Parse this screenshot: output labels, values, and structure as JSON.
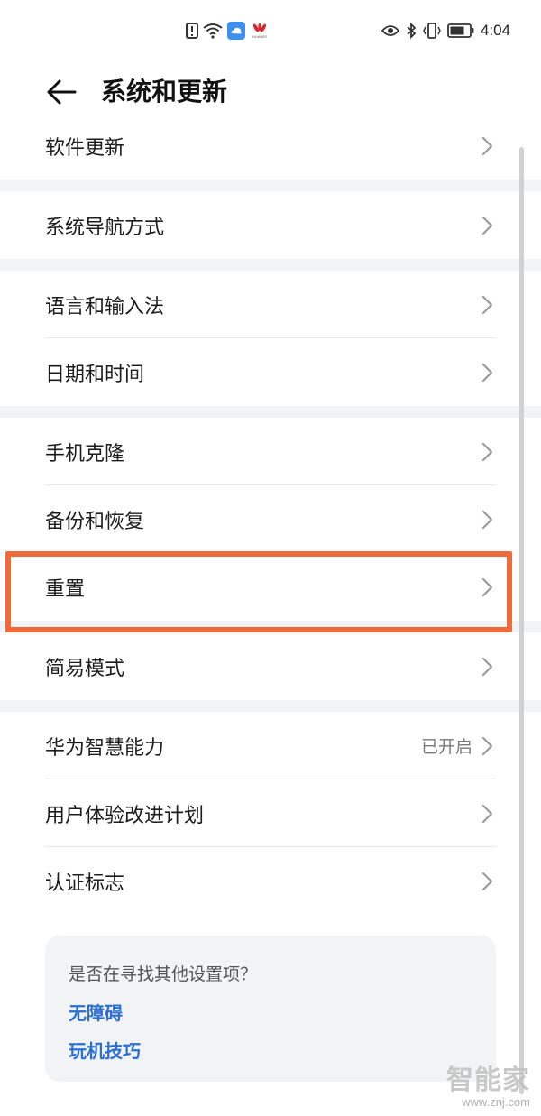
{
  "status_bar": {
    "time": "4:04",
    "brand_text": "HUAWEI",
    "icons_left": [
      "alert-icon",
      "wifi-icon",
      "cloud-icon",
      "huawei-logo-icon"
    ],
    "icons_right": [
      "eye-comfort-icon",
      "bluetooth-icon",
      "vibrate-icon",
      "battery-icon"
    ]
  },
  "header": {
    "back_icon": "arrow-left-icon",
    "title": "系统和更新"
  },
  "groups": [
    {
      "items": [
        {
          "label": "软件更新"
        }
      ]
    },
    {
      "items": [
        {
          "label": "系统导航方式"
        }
      ]
    },
    {
      "items": [
        {
          "label": "语言和输入法"
        },
        {
          "label": "日期和时间"
        }
      ]
    },
    {
      "items": [
        {
          "label": "手机克隆"
        },
        {
          "label": "备份和恢复"
        },
        {
          "label": "重置"
        }
      ]
    },
    {
      "items": [
        {
          "label": "简易模式"
        }
      ]
    },
    {
      "items": [
        {
          "label": "华为智慧能力",
          "value": "已开启"
        },
        {
          "label": "用户体验改进计划"
        },
        {
          "label": "认证标志"
        }
      ]
    }
  ],
  "suggestion_card": {
    "question": "是否在寻找其他设置项？",
    "links": [
      "无障碍",
      "玩机技巧"
    ]
  },
  "watermark": {
    "logo": "智能家",
    "url": "www.znj.com"
  },
  "colors": {
    "highlight": "#f06a3a",
    "link": "#2c6fd0",
    "background": "#f1f3f5"
  }
}
